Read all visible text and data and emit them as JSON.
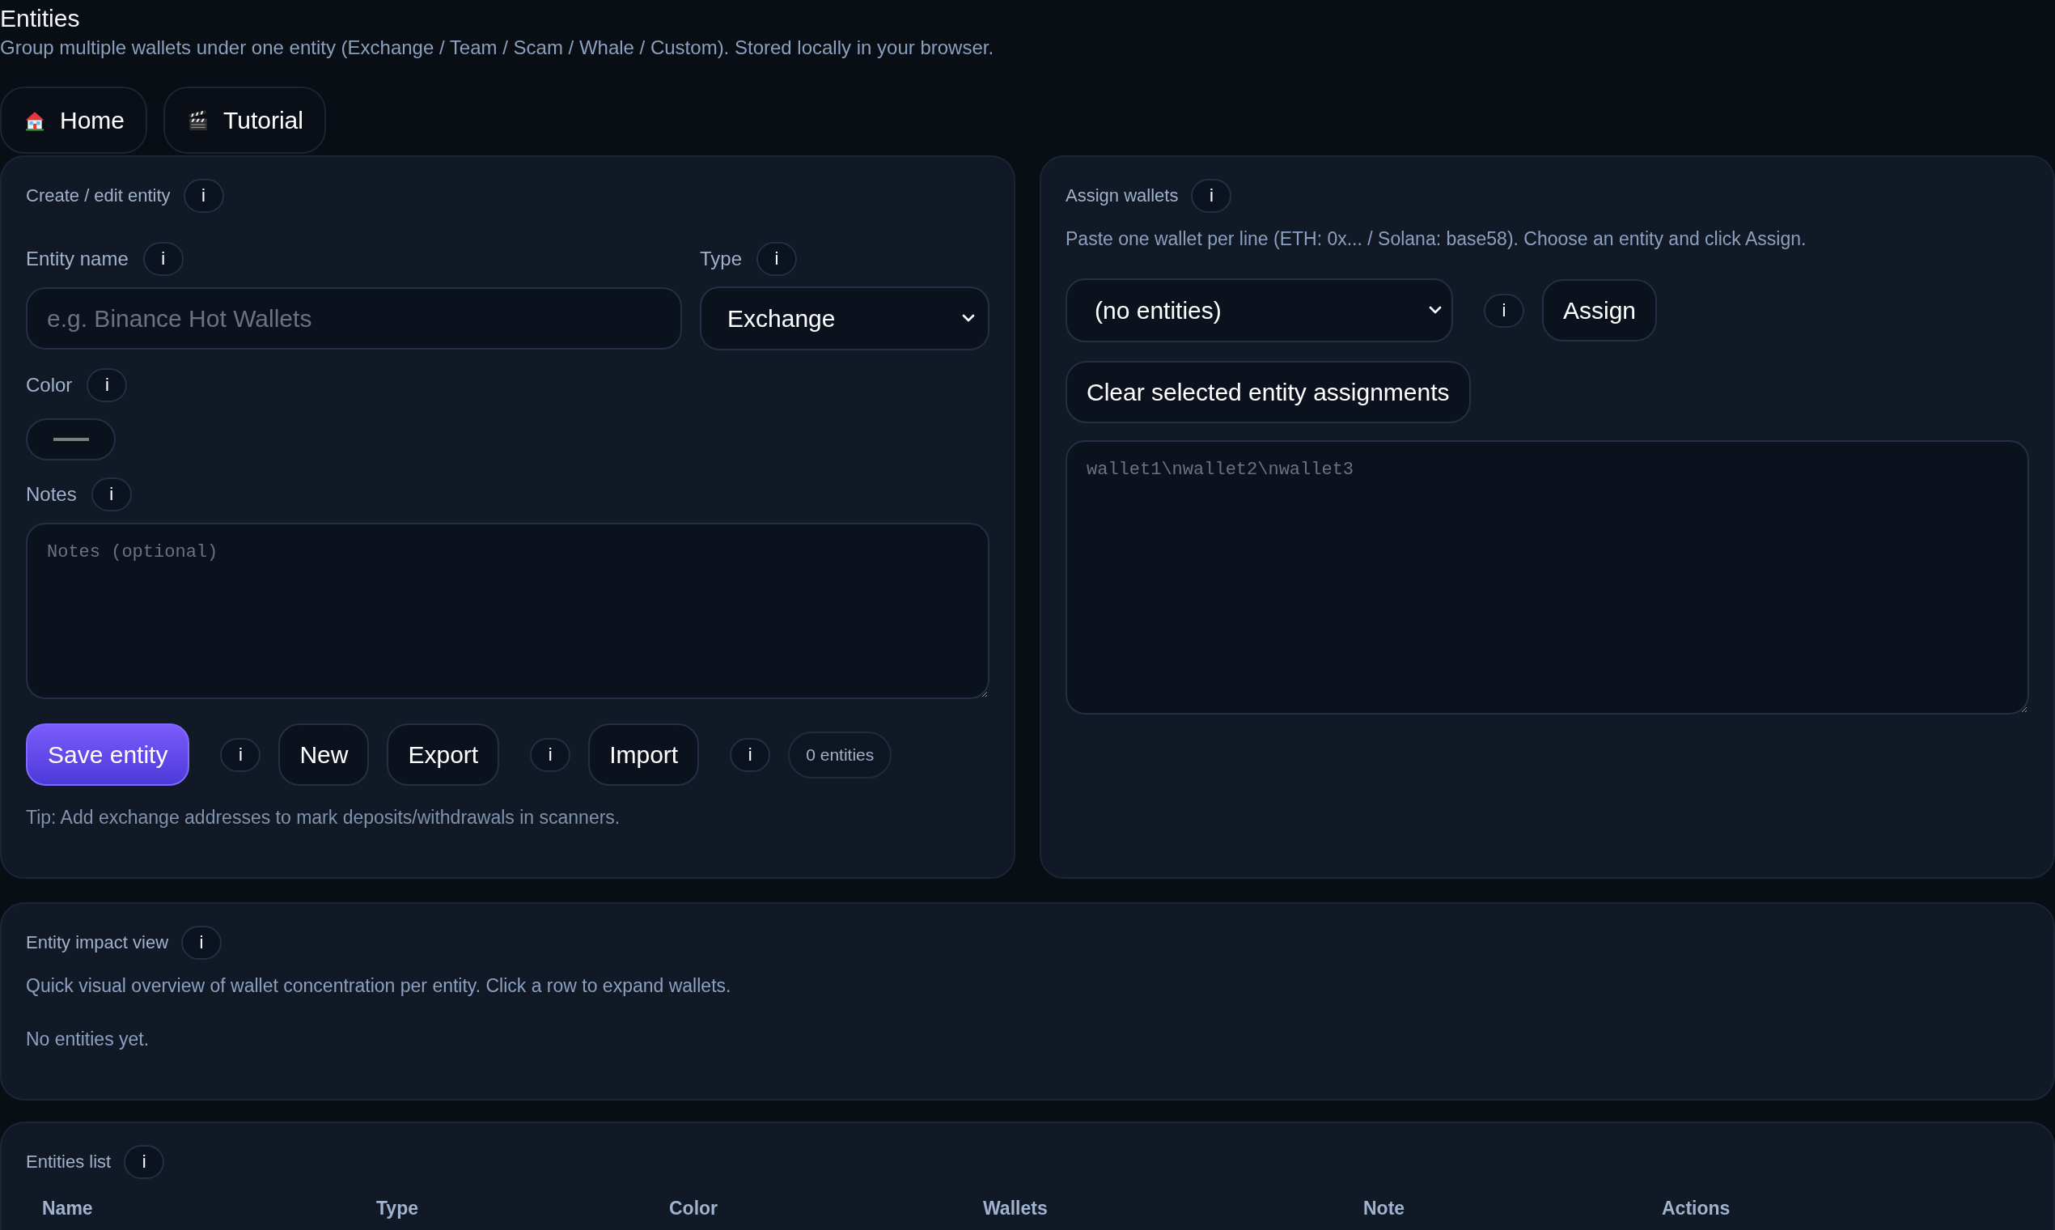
{
  "header": {
    "title": "Entities",
    "subtitle": "Group multiple wallets under one entity (Exchange / Team / Scam / Whale / Custom). Stored locally in your browser."
  },
  "nav": [
    {
      "kind": "home",
      "label": "Home"
    },
    {
      "kind": "tutorial",
      "label": "Tutorial"
    }
  ],
  "create_panel": {
    "title": "Create / edit entity",
    "info": "i",
    "name_field": {
      "label": "Entity name",
      "info": "i",
      "placeholder": "e.g. Binance Hot Wallets"
    },
    "type_field": {
      "label": "Type",
      "info": "i",
      "value": "Exchange"
    },
    "color_field": {
      "label": "Color",
      "info": "i"
    },
    "notes_field": {
      "label": "Notes",
      "info": "i",
      "placeholder": "Notes (optional)"
    },
    "actions": [
      {
        "kind": "save",
        "label": "Save entity"
      },
      {
        "kind": "info",
        "label": "i"
      },
      {
        "kind": "new",
        "label": "New"
      },
      {
        "kind": "export",
        "label": "Export"
      },
      {
        "kind": "info",
        "label": "i"
      },
      {
        "kind": "import",
        "label": "Import"
      },
      {
        "kind": "info",
        "label": "i"
      },
      {
        "kind": "count",
        "label": "0 entities"
      }
    ],
    "tip": "Tip: Add exchange addresses to mark deposits/withdrawals in scanners."
  },
  "assign_panel": {
    "title": "Assign wallets",
    "info": "i",
    "description": "Paste one wallet per line (ETH: 0x... / Solana: base58). Choose an entity and click Assign.",
    "entity_select": {
      "value": "(no entities)"
    },
    "actions": [
      {
        "kind": "info",
        "label": "i"
      },
      {
        "kind": "assign",
        "label": "Assign"
      }
    ],
    "clear_button": {
      "label": "Clear selected entity assignments"
    },
    "wallets_field": {
      "placeholder": "wallet1\\nwallet2\\nwallet3"
    }
  },
  "impact_panel": {
    "title": "Entity impact view",
    "info": "i",
    "description": "Quick visual overview of wallet concentration per entity. Click a row to expand wallets.",
    "empty_text": "No entities yet."
  },
  "list_panel": {
    "title": "Entities list",
    "info": "i",
    "table": {
      "columns": [
        "Name",
        "Type",
        "Color",
        "Wallets",
        "Note",
        "Actions"
      ]
    }
  }
}
